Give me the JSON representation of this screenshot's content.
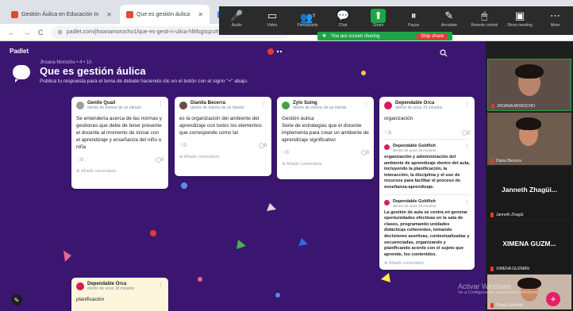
{
  "browser": {
    "tabs": [
      {
        "label": "Gestión Áulica en Educación In",
        "active": false
      },
      {
        "label": "Que es gestión áulica",
        "active": true
      },
      {
        "label": "G",
        "active": false
      }
    ],
    "nav": {
      "back": "←",
      "forward": "→",
      "reload": "C"
    },
    "url": "padlet.com/jhoanamorocho1/que-es-gesti-n-ulica-hl8fsgsqzuhvv"
  },
  "meeting": {
    "buttons": [
      {
        "label": "Audio",
        "glyph": "🎤"
      },
      {
        "label": "Video",
        "glyph": "▭"
      },
      {
        "label": "Participants",
        "glyph": "👥",
        "badge": "5"
      },
      {
        "label": "Chat",
        "glyph": "💬"
      },
      {
        "label": "Share",
        "glyph": "⬆"
      },
      {
        "label": "Pause",
        "glyph": "⏸"
      },
      {
        "label": "Annotate",
        "glyph": "✎"
      },
      {
        "label": "Remote control",
        "glyph": "🖱"
      },
      {
        "label": "Show meeting",
        "glyph": "▣"
      },
      {
        "label": "More",
        "glyph": "⋯"
      }
    ],
    "sharing_text": "You are screen sharing",
    "stop_label": "Stop share"
  },
  "padlet": {
    "brand": "Padlet",
    "author": "Jhoana Morocho • 4 • 1h",
    "title": "Que es gestión áulica",
    "subtitle": "Publica tu respuesta para el tema de debate haciendo clic en el botón con el signo \"+\" abajo.",
    "add_comment": "Añadir comentario",
    "fab": "+",
    "cards": [
      {
        "name": "Gentle Quail",
        "time": "dentro de menos de un minuto",
        "avatar": "#9e9e9e",
        "body": "Se entendería acerca de las normas y gestiones que debe de tener presente el docente al momento de iniciar con el aprendizaje y enseñanza del niño o niña",
        "likes": "0",
        "comments": "0"
      },
      {
        "name": "Dianita Becerra",
        "time": "dentro de menos de un minuto",
        "avatar": "#6d4c41",
        "body": "es la organización del ambiente del aprendizaje con todos los elementos que corresponde como tal",
        "likes": "0",
        "comments": "0"
      },
      {
        "name": "Zylo Suing",
        "time": "dentro de menos de un minuto",
        "avatar": "#43a047",
        "body": "Gestión áulica\nSerie de estrategias que el docente implementa para crear un ambiente de aprendizaje significativo",
        "likes": "0",
        "comments": "0"
      },
      {
        "name": "Dependable Orca",
        "time": "dentro de unos 19 minutos",
        "avatar": "#d81b60",
        "body": "organización",
        "likes": "3",
        "comments": "2",
        "replies": [
          {
            "name": "Dependable Goldfish",
            "time": "dentro de unos 19 minutos",
            "body": "organización y administración del ambiente de aprendizaje dentro del aula, incluyendo la planificación, la interacción, la disciplina y el uso de recursos para facilitar el proceso de enseñanza-aprendizaje."
          },
          {
            "name": "Dependable Goldfish",
            "time": "dentro de unos 19 minutos",
            "body": "La gestión de aula se centra en generar oportunidades efectivas en la sala de clases, programando unidades didácticas coherentes, tomando decisiones asertivas, contextualizadas y secuenciadas, organizando y planificando acorde con el sujeto que aprende, los contenidos."
          }
        ]
      },
      {
        "name": "Dependable Orca",
        "time": "dentro de unos 18 minutos",
        "avatar": "#d81b60",
        "body": "planificación"
      }
    ]
  },
  "participants": [
    {
      "name": "JHOANA MOROCHO",
      "type": "video"
    },
    {
      "name": "Diana Becerra",
      "type": "video"
    },
    {
      "name": "Janneth Zhagüi...",
      "sub": "Janneth Zhagüi",
      "type": "name"
    },
    {
      "name": "XIMENA GUZM...",
      "sub": "XIMENA GUZMÁN",
      "type": "name"
    },
    {
      "name": "Diana Gabrielle",
      "type": "video"
    }
  ],
  "watermark": {
    "line1": "Activar Windows",
    "line2": "Ve a Configuración para activar Windows."
  }
}
